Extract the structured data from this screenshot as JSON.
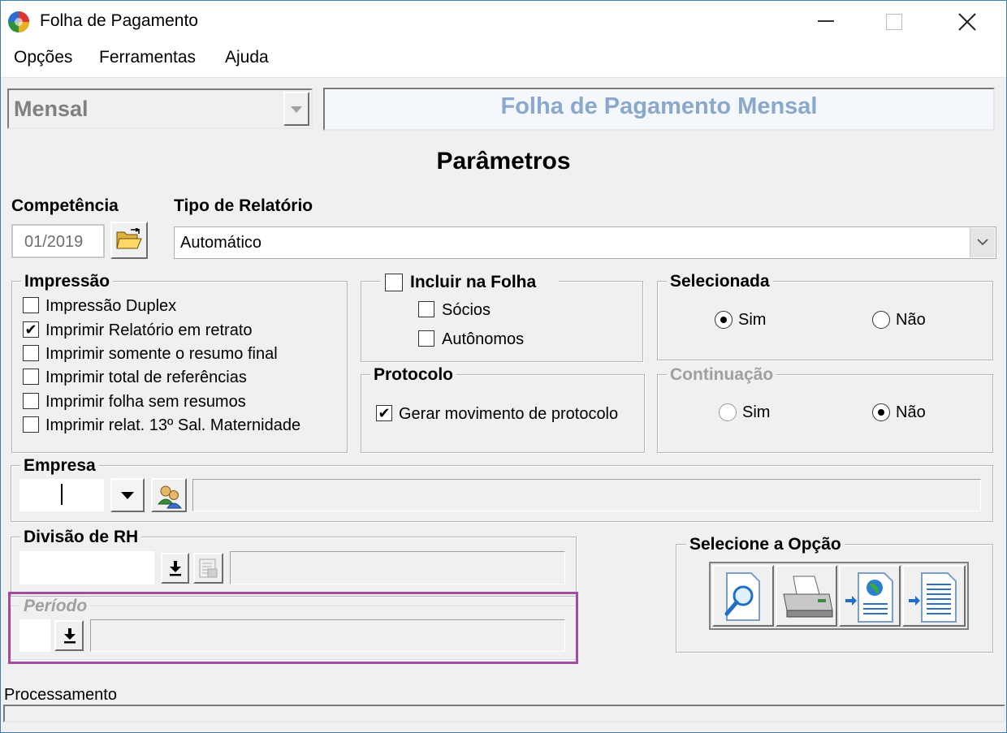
{
  "window": {
    "title": "Folha de Pagamento"
  },
  "menu": [
    "Opções",
    "Ferramentas",
    "Ajuda"
  ],
  "tipo_folha": {
    "value": "Mensal"
  },
  "banner": "Folha de Pagamento Mensal",
  "section_title": "Parâmetros",
  "competencia": {
    "label": "Competência",
    "value": "01/2019"
  },
  "tipo_relatorio": {
    "label": "Tipo de Relatório",
    "value": "Automático"
  },
  "impressao": {
    "legend": "Impressão",
    "options": [
      {
        "label": "Impressão Duplex",
        "checked": false
      },
      {
        "label": "Imprimir Relatório em retrato",
        "checked": true
      },
      {
        "label": "Imprimir somente o resumo final",
        "checked": false
      },
      {
        "label": "Imprimir total de referências",
        "checked": false
      },
      {
        "label": "Imprimir folha sem resumos",
        "checked": false
      },
      {
        "label": "Imprimir relat. 13º Sal. Maternidade",
        "checked": false
      }
    ]
  },
  "incluir": {
    "legend": "Incluir na Folha",
    "checked": false,
    "options": [
      {
        "label": "Sócios",
        "checked": false
      },
      {
        "label": "Autônomos",
        "checked": false
      }
    ]
  },
  "protocolo": {
    "legend": "Protocolo",
    "option": {
      "label": "Gerar movimento de protocolo",
      "checked": true
    }
  },
  "selecionada": {
    "legend": "Selecionada",
    "sim": "Sim",
    "nao": "Não",
    "selected": "Sim"
  },
  "continuacao": {
    "legend": "Continuação",
    "sim": "Sim",
    "nao": "Não",
    "selected": "Não"
  },
  "empresa": {
    "legend": "Empresa",
    "code": "",
    "name": ""
  },
  "divisao": {
    "legend": "Divisão de RH",
    "code": "",
    "name": ""
  },
  "periodo": {
    "legend": "Período",
    "code": "",
    "name": "",
    "highlight_color": "#a04ca0"
  },
  "opcoes": {
    "legend": "Selecione a Opção"
  },
  "status": {
    "label": "Processamento"
  }
}
